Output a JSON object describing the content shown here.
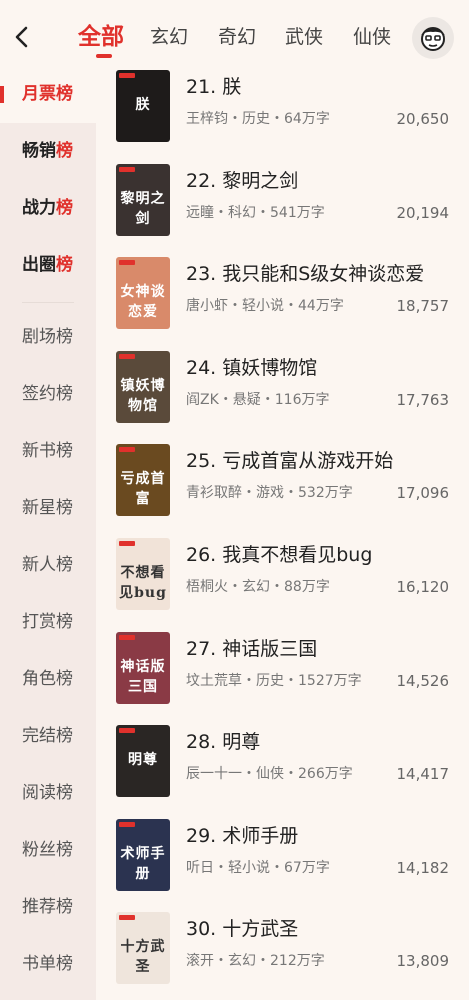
{
  "header": {
    "back_icon": "chevron-left-icon",
    "tabs": [
      {
        "label": "全部",
        "active": true
      },
      {
        "label": "玄幻"
      },
      {
        "label": "奇幻"
      },
      {
        "label": "武侠"
      },
      {
        "label": "仙侠"
      }
    ],
    "avatar_icon": "user-avatar-icon"
  },
  "sidebar": {
    "items": [
      {
        "label": "月票榜",
        "active": true
      },
      {
        "label": "畅销榜"
      },
      {
        "label": "战力榜"
      },
      {
        "label": "出圈榜"
      },
      {
        "label": "剧场榜"
      },
      {
        "label": "签约榜"
      },
      {
        "label": "新书榜"
      },
      {
        "label": "新星榜"
      },
      {
        "label": "新人榜"
      },
      {
        "label": "打赏榜"
      },
      {
        "label": "角色榜"
      },
      {
        "label": "完结榜"
      },
      {
        "label": "阅读榜"
      },
      {
        "label": "粉丝榜"
      },
      {
        "label": "推荐榜"
      },
      {
        "label": "书单榜"
      }
    ]
  },
  "books": [
    {
      "rank": "21.",
      "title": "朕",
      "meta": "王梓钧・历史・64万字",
      "votes": "20,650",
      "cover_text": "朕",
      "cover_color": "#1e1b1a"
    },
    {
      "rank": "22.",
      "title": "黎明之剑",
      "meta": "远瞳・科幻・541万字",
      "votes": "20,194",
      "cover_text": "黎明之剑",
      "cover_color": "#3a3230"
    },
    {
      "rank": "23.",
      "title": "我只能和S级女神谈恋爱",
      "meta": "唐小虾・轻小说・44万字",
      "votes": "18,757",
      "cover_text": "女神谈恋爱",
      "cover_color": "#d98a6a"
    },
    {
      "rank": "24.",
      "title": "镇妖博物馆",
      "meta": "阎ZK・悬疑・116万字",
      "votes": "17,763",
      "cover_text": "镇妖博物馆",
      "cover_color": "#5a4a3a"
    },
    {
      "rank": "25.",
      "title": "亏成首富从游戏开始",
      "meta": "青衫取醉・游戏・532万字",
      "votes": "17,096",
      "cover_text": "亏成首富",
      "cover_color": "#6a4a20"
    },
    {
      "rank": "26.",
      "title": "我真不想看见bug",
      "meta": "梧桐火・玄幻・88万字",
      "votes": "16,120",
      "cover_text": "不想看见bug",
      "cover_color": "#f1e3d8"
    },
    {
      "rank": "27.",
      "title": "神话版三国",
      "meta": "坟土荒草・历史・1527万字",
      "votes": "14,526",
      "cover_text": "神话版三国",
      "cover_color": "#8a3a45"
    },
    {
      "rank": "28.",
      "title": "明尊",
      "meta": "辰一十一・仙侠・266万字",
      "votes": "14,417",
      "cover_text": "明尊",
      "cover_color": "#2a2624"
    },
    {
      "rank": "29.",
      "title": "术师手册",
      "meta": "听日・轻小说・67万字",
      "votes": "14,182",
      "cover_text": "术师手册",
      "cover_color": "#2b3350"
    },
    {
      "rank": "30.",
      "title": "十方武圣",
      "meta": "滚开・玄幻・212万字",
      "votes": "13,809",
      "cover_text": "十方武圣",
      "cover_color": "#efe5dc"
    }
  ]
}
